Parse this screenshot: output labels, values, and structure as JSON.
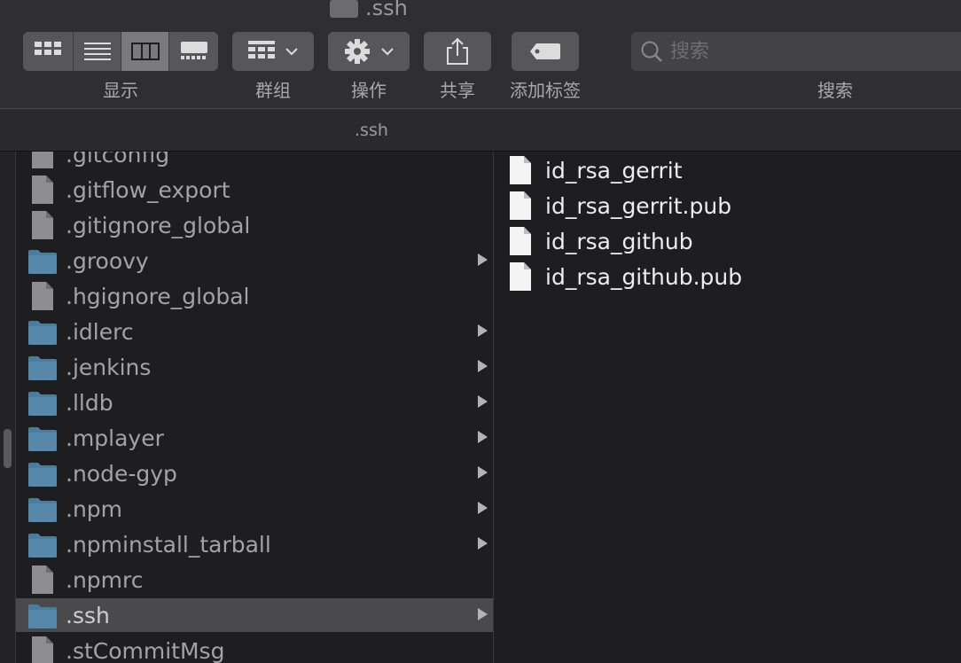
{
  "window": {
    "title": ".ssh"
  },
  "toolbar": {
    "view_label": "显示",
    "group_label": "群组",
    "action_label": "操作",
    "share_label": "共享",
    "tag_label": "添加标签",
    "search_label": "搜索",
    "search_placeholder": "搜索",
    "active_view": "column"
  },
  "pathbar": {
    "title": ".ssh"
  },
  "column1": {
    "items": [
      {
        "name": ".gitconfig",
        "kind": "file",
        "has_children": false
      },
      {
        "name": ".gitflow_export",
        "kind": "file",
        "has_children": false
      },
      {
        "name": ".gitignore_global",
        "kind": "file",
        "has_children": false
      },
      {
        "name": ".groovy",
        "kind": "folder",
        "has_children": true
      },
      {
        "name": ".hgignore_global",
        "kind": "file",
        "has_children": false
      },
      {
        "name": ".idlerc",
        "kind": "folder",
        "has_children": true
      },
      {
        "name": ".jenkins",
        "kind": "folder",
        "has_children": true
      },
      {
        "name": ".lldb",
        "kind": "folder",
        "has_children": true
      },
      {
        "name": ".mplayer",
        "kind": "folder",
        "has_children": true
      },
      {
        "name": ".node-gyp",
        "kind": "folder",
        "has_children": true
      },
      {
        "name": ".npm",
        "kind": "folder",
        "has_children": true
      },
      {
        "name": ".npminstall_tarball",
        "kind": "folder",
        "has_children": true
      },
      {
        "name": ".npmrc",
        "kind": "file",
        "has_children": false
      },
      {
        "name": ".ssh",
        "kind": "folder",
        "has_children": true,
        "selected": true
      },
      {
        "name": ".stCommitMsg",
        "kind": "file",
        "has_children": false
      }
    ]
  },
  "column2": {
    "items": [
      {
        "name": "id_rsa_gerrit"
      },
      {
        "name": "id_rsa_gerrit.pub"
      },
      {
        "name": "id_rsa_github"
      },
      {
        "name": "id_rsa_github.pub"
      }
    ]
  },
  "colors": {
    "folder": "#4d7d9c",
    "selection": "#4a4a4c",
    "toolbar": "#2f2f31"
  }
}
